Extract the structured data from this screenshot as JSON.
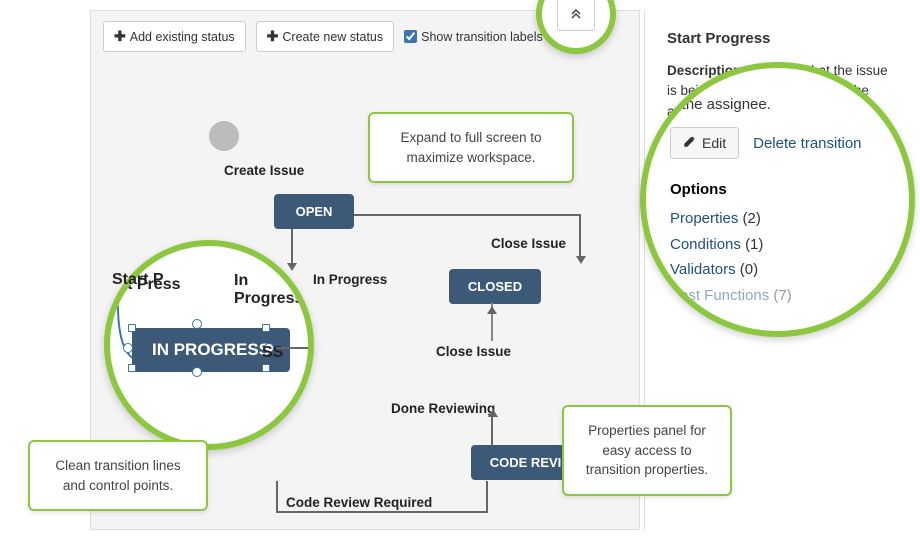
{
  "toolbar": {
    "add_existing": "Add existing status",
    "create_new": "Create new status",
    "show_labels": "Show transition labels"
  },
  "nodes": {
    "open": "OPEN",
    "closed": "CLOSED",
    "code_review": "CODE REVIEW",
    "in_progress": "IN PROGRESS"
  },
  "transitions": {
    "create_issue": "Create Issue",
    "start_progress": "Start Progress",
    "in_progress": "In Progress",
    "close_issue": "Close Issue",
    "done_reviewing": "Done Reviewing",
    "code_review_required": "Code Review Required"
  },
  "mag": {
    "ss_suffix": "SS",
    "ress": "ress",
    "start_prefix": "Start P"
  },
  "callouts": {
    "expand": "Expand to full screen to maximize workspace.",
    "lines": "Clean transition lines and control points.",
    "panel": "Properties panel for easy access to transition properties."
  },
  "rightpanel": {
    "title": "Start Progress",
    "desc_label": "Description:",
    "desc_text": "Indicates that the issue is being actively worked on by the assignee.",
    "assignee_frag": "y the assignee.",
    "edit": "Edit",
    "delete": "Delete transition",
    "options_head": "Options",
    "opts": {
      "properties": {
        "label": "Properties",
        "count": "(2)"
      },
      "conditions": {
        "label": "Conditions",
        "count": "(1)"
      },
      "validators": {
        "label": "Validators",
        "count": "(0)"
      },
      "functions": {
        "label": "Post Functions",
        "count": "(7)"
      }
    }
  }
}
